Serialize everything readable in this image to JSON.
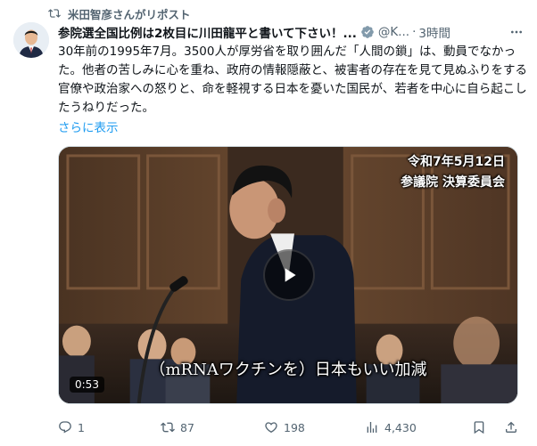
{
  "repost_banner": {
    "text": "米田智彦さんがリポスト"
  },
  "post": {
    "display_name": "参院選全国比例は2枚目に川田龍平と書いて下さい！...",
    "handle": "@K...",
    "separator": "·",
    "time": "3時間",
    "body": "30年前の1995年7月。3500人が厚労省を取り囲んだ「人間の鎖」は、動員でなかった。他者の苦しみに心を重ね、政府の情報隠蔽と、被害者の存在を見て見ぬふりをする官僚や政治家への怒りと、命を軽視する日本を憂いた国民が、若者を中心に自ら起こしたうねりだった。",
    "show_more": "さらに表示"
  },
  "media": {
    "caption_line1": "令和7年5月12日",
    "caption_line2": "参議院 決算委員会",
    "subtitle": "（mRNAワクチンを）日本もいい加減",
    "duration": "0:53"
  },
  "actions": {
    "replies": "1",
    "reposts": "87",
    "likes": "198",
    "views": "4,430"
  },
  "colors": {
    "accent": "#1d9bf0",
    "muted": "#536471",
    "verified": "#829aab"
  }
}
